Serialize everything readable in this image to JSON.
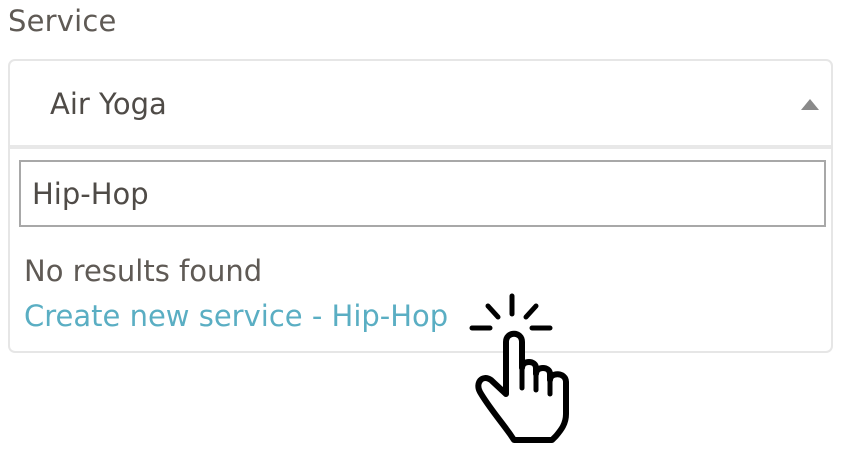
{
  "field": {
    "label": "Service"
  },
  "select": {
    "selected_value": "Air Yoga",
    "caret_icon": "caret-up-icon",
    "search": {
      "value": "Hip-Hop",
      "placeholder": ""
    },
    "no_results_text": "No results found",
    "create_link_label": "Create new service - Hip-Hop"
  },
  "overlay": {
    "cursor_icon": "hand-click-cursor-icon"
  },
  "colors": {
    "label_text": "#5f5a55",
    "value_text": "#4f4b47",
    "link": "#5aaec3",
    "border": "#e6e6e6",
    "input_border": "#a8a8a8",
    "caret": "#8a8a8a"
  }
}
